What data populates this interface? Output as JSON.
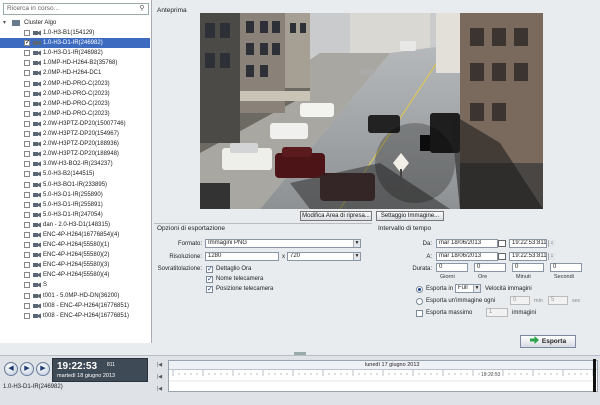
{
  "search": {
    "placeholder": "Ricerca in corso..."
  },
  "tree": {
    "root_label": "Cluster Algo",
    "items": [
      {
        "label": "1.0-H3-B1(154129)",
        "checked": false,
        "selected": false
      },
      {
        "label": "1.0-H3-D1-IR(246982)",
        "checked": true,
        "selected": true
      },
      {
        "label": "1.0-H3-D1-IR(246982)",
        "checked": false,
        "selected": false
      },
      {
        "label": "1.0MP-HD-H264-B2(35768)",
        "checked": false,
        "selected": false
      },
      {
        "label": "2.0MP-HD-H264-DC1",
        "checked": false,
        "selected": false
      },
      {
        "label": "2.0MP-HD-PRO-C(2023)",
        "checked": false,
        "selected": false
      },
      {
        "label": "2.0MP-HD-PRO-C(2023)",
        "checked": false,
        "selected": false
      },
      {
        "label": "2.0MP-HD-PRO-C(2023)",
        "checked": false,
        "selected": false
      },
      {
        "label": "2.0MP-HD-PRO-C(2023)",
        "checked": false,
        "selected": false
      },
      {
        "label": "2.0W-H3PTZ-DP20(15007746)",
        "checked": false,
        "selected": false
      },
      {
        "label": "2.0W-H3PTZ-DP20(154967)",
        "checked": false,
        "selected": false
      },
      {
        "label": "2.0W-H3PTZ-DP20(188936)",
        "checked": false,
        "selected": false
      },
      {
        "label": "2.0W-H3PTZ-DP20(188948)",
        "checked": false,
        "selected": false
      },
      {
        "label": "3.0W-H3-BO2-IR(234237)",
        "checked": false,
        "selected": false
      },
      {
        "label": "5.0-H3-B2(144515)",
        "checked": false,
        "selected": false
      },
      {
        "label": "5.0-H3-BO1-IR(233895)",
        "checked": false,
        "selected": false
      },
      {
        "label": "5.0-H3-D1-IR(255890)",
        "checked": false,
        "selected": false
      },
      {
        "label": "5.0-H3-D1-IR(255891)",
        "checked": false,
        "selected": false
      },
      {
        "label": "5.0-H3-D1-IR(247054)",
        "checked": false,
        "selected": false
      },
      {
        "label": "dan - 2.0-H3-D1(148315)",
        "checked": false,
        "selected": false
      },
      {
        "label": "ENC-4P-H264(16776854)(4)",
        "checked": false,
        "selected": false
      },
      {
        "label": "ENC-4P-H264(55580)(1)",
        "checked": false,
        "selected": false
      },
      {
        "label": "ENC-4P-H264(55580)(2)",
        "checked": false,
        "selected": false
      },
      {
        "label": "ENC-4P-H264(55580)(3)",
        "checked": false,
        "selected": false
      },
      {
        "label": "ENC-4P-H264(55580)(4)",
        "checked": false,
        "selected": false
      },
      {
        "label": "S",
        "checked": false,
        "selected": false
      },
      {
        "label": "t001 - 5.0MP-HD-DN(36200)",
        "checked": false,
        "selected": false
      },
      {
        "label": "t008 - ENC-4P-H264(16776851)",
        "checked": false,
        "selected": false
      },
      {
        "label": "t008 - ENC-4P-H264(16776851)",
        "checked": false,
        "selected": false
      }
    ]
  },
  "preview": {
    "title": "Anteprima",
    "modify_area_label": "Modifica Area di ripresa...",
    "image_settings_label": "Settaggio Immagine..."
  },
  "export_options": {
    "title": "Opzioni di esportazione",
    "format_label": "Formato:",
    "format_value": "Immagini PNG",
    "resolution_label": "Risoluzione:",
    "res_width": "1280",
    "res_x": "x",
    "res_height": "720",
    "overlay_label": "Sovratitolazione:",
    "overlays": [
      {
        "label": "Dettaglio Ora",
        "checked": true
      },
      {
        "label": "Nome telecamera",
        "checked": true
      },
      {
        "label": "Posizione telecamera",
        "checked": true
      }
    ]
  },
  "time_interval": {
    "title": "Intervallo di tempo",
    "from_label": "Da:",
    "from_date": "mar 18/06/2013",
    "from_time": "19:22:53:811",
    "to_label": "A:",
    "to_date": "mar 18/06/2013",
    "to_time": "19:22:53:811",
    "duration_label": "Durata:",
    "duration_values": [
      "0",
      "0",
      "0",
      "0"
    ],
    "duration_units": [
      "Giorni",
      "Ore",
      "Minuti",
      "Secondi"
    ],
    "export_in_label": "Esporta in",
    "export_in_value": "Full",
    "speed_label": "Velocità immagini",
    "one_image_label": "Esporta un'immagine ogni",
    "one_image_min": "0",
    "min_label": "min",
    "one_image_sec": "5",
    "sec_label": "sec",
    "max_label": "Esporta massimo",
    "max_value": "1",
    "images_label": "immagini"
  },
  "export_button": {
    "label": "Esporta"
  },
  "player": {
    "clock_time": "19:22:53",
    "clock_ms": "811",
    "clock_date": "martedì 18 giugno 2013",
    "camera_label": "1.0-H3-D1-IR(246982)",
    "timeline_date": "lunedì 17 giugno 2013",
    "timeline_time": "19:22:53"
  },
  "colors": {
    "selection": "#3d6bc0",
    "accent_green": "#2aa34a",
    "panel_bg": "#e9ecef"
  }
}
